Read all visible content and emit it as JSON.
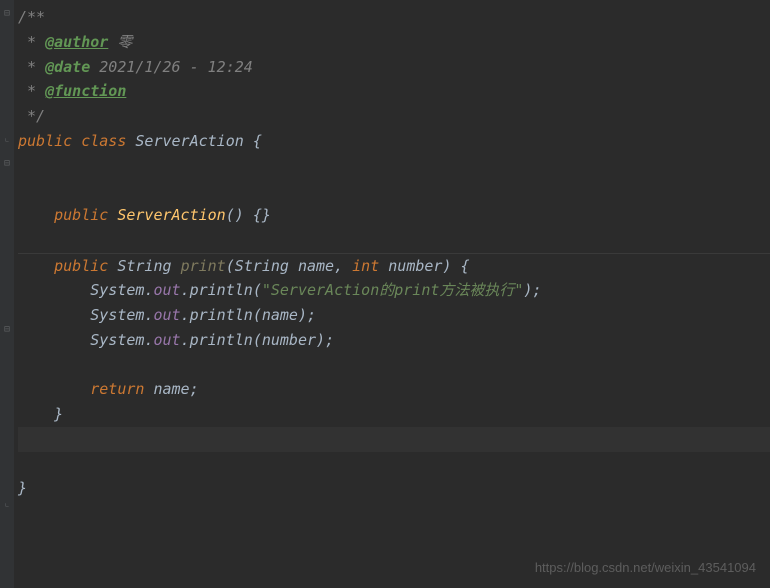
{
  "comment": {
    "open": "/**",
    "star": " * ",
    "authorTag": "@author",
    "authorVal": " 零",
    "dateTag": "@date",
    "dateVal": " 2021/1/26 - 12:24",
    "funcTag": "@function",
    "close": " */"
  },
  "code": {
    "kw_public": "public",
    "kw_class": "class",
    "kw_int": "int",
    "kw_return": "return",
    "cls_ServerAction": "ServerAction",
    "cls_String": "String",
    "cls_System": "System",
    "field_out": "out",
    "m_println": "println",
    "m_print": "print",
    "ctor": "ServerAction",
    "p_name": "name",
    "p_number": "number",
    "str_msg": "\"ServerAction的print方法被执行\"",
    "brace_open": "{",
    "brace_close": "}",
    "paren_open": "(",
    "paren_close": ")",
    "empty_braces": "{}",
    "comma": ", ",
    "semi": ";",
    "dot": "."
  },
  "watermark": "https://blog.csdn.net/weixin_43541094"
}
